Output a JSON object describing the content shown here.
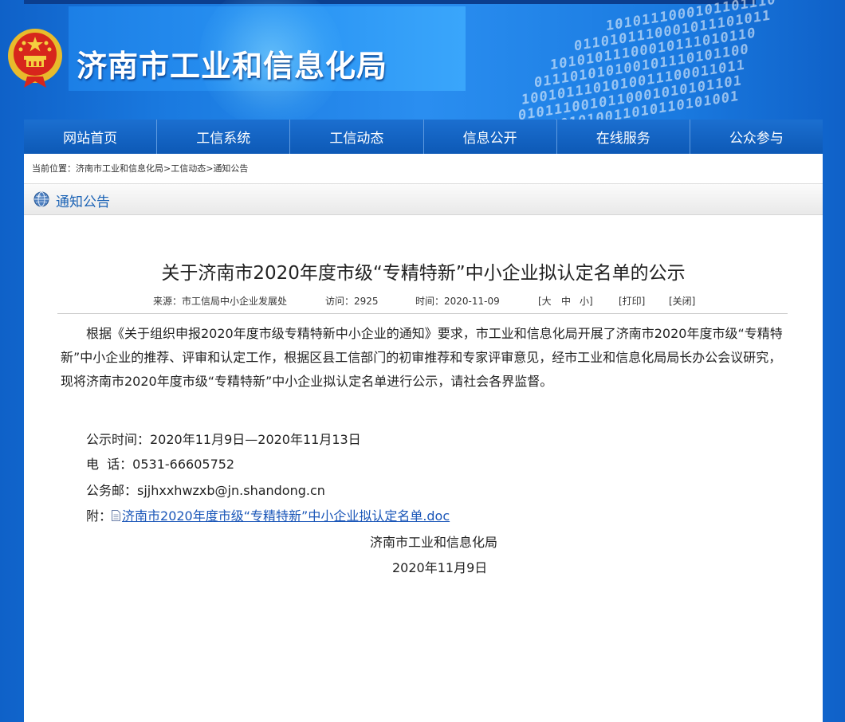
{
  "header": {
    "site_title": "济南市工业和信息化局",
    "digit_rows": [
      "1010111000101101110",
      "0110101110001011101011",
      "10101011100010111010110",
      "011101010100101110101100",
      "1001011101010011100011011",
      "0101110010110001010101101",
      "1101010011010110101001"
    ]
  },
  "nav": {
    "items": [
      "网站首页",
      "工信系统",
      "工信动态",
      "信息公开",
      "在线服务",
      "公众参与"
    ]
  },
  "breadcrumb": {
    "label": "当前位置：",
    "parts": [
      "济南市工业和信息化局",
      "工信动态",
      "通知公告"
    ],
    "separator": ">"
  },
  "section": {
    "title": "通知公告"
  },
  "article": {
    "title": "关于济南市2020年度市级“专精特新”中小企业拟认定名单的公示",
    "meta": {
      "source": "来源：市工信局中小企业发展处",
      "visits": "访问：2925",
      "date": "时间：2020-11-09",
      "font_open": "[大",
      "font_medium": "中",
      "font_small": "小]",
      "print": "[打印]",
      "close": "[关闭]"
    },
    "body": "根据《关于组织申报2020年度市级专精特新中小企业的通知》要求，市工业和信息化局开展了济南市2020年度市级“专精特新”中小企业的推荐、评审和认定工作，根据区县工信部门的初审推荐和专家评审意见，经市工业和信息化局局长办公会议研究，现将济南市2020年度市级“专精特新”中小企业拟认定名单进行公示，请社会各界监督。",
    "period": "公示时间：2020年11月9日—2020年11月13日",
    "phone": "电  话：0531-66605752",
    "email": "公务邮：sjjhxxhwzxb@jn.shandong.cn",
    "attach_label": "附：",
    "attach_file": "济南市2020年度市级“专精特新”中小企业拟认定名单.doc",
    "sign_org": "济南市工业和信息化局",
    "sign_date": "2020年11月9日"
  }
}
